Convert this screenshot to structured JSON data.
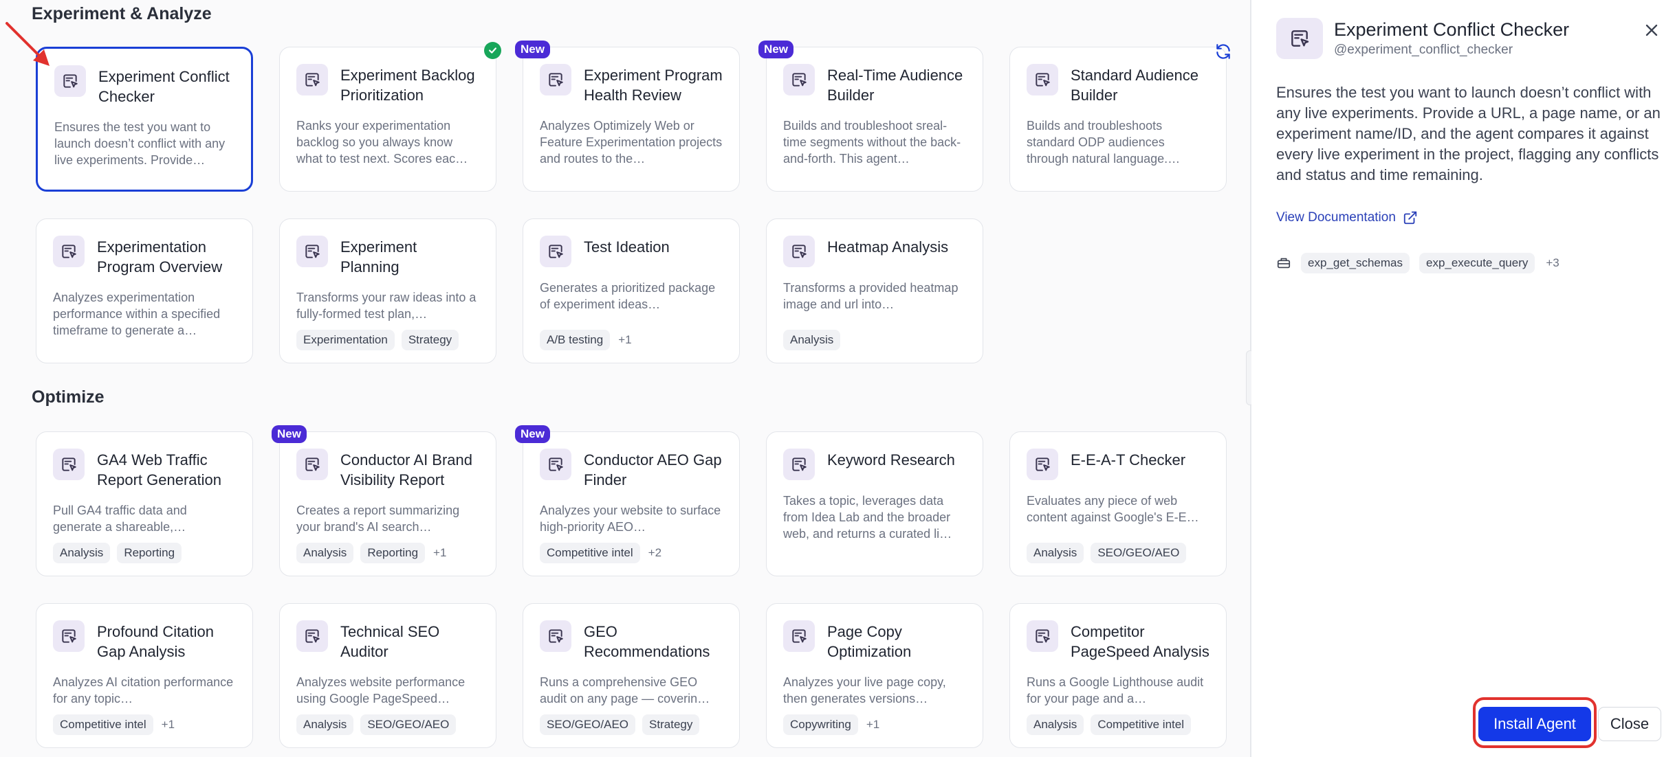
{
  "sections": {
    "experiment": {
      "title": "Experiment & Analyze"
    },
    "optimize": {
      "title": "Optimize"
    }
  },
  "experiment_cards": [
    {
      "title": "Experiment Conflict Checker",
      "desc": "Ensures the test you want to launch doesn’t conflict with any live experiments. Provide…",
      "tags": [],
      "more": "",
      "badge": "",
      "selected": true
    },
    {
      "title": "Experiment Backlog Prioritization",
      "desc": "Ranks your experimentation backlog so you always know what to test next. Scores eac…",
      "tags": [],
      "more": "",
      "badge": "check"
    },
    {
      "title": "Experiment Program Health Review",
      "desc": "Analyzes Optimizely Web or Feature Experimentation projects and routes to the…",
      "tags": [],
      "more": "",
      "badge": "New"
    },
    {
      "title": "Real-Time Audience Builder",
      "desc": "Builds and troubleshoot sreal-time segments without the back-and-forth. This agent…",
      "tags": [],
      "more": "",
      "badge": "New"
    },
    {
      "title": "Standard Audience Builder",
      "desc": "Builds and troubleshoots standard ODP audiences through natural language.…",
      "tags": [],
      "more": "",
      "badge": ""
    },
    {
      "title": "Experimentation Program Overview",
      "desc": "Analyzes experimentation performance within a specified timeframe to generate a…",
      "tags": [],
      "more": "",
      "badge": ""
    },
    {
      "title": "Experiment Planning",
      "desc": "Transforms your raw ideas into a fully-formed test plan,…",
      "tags": [
        "Experimentation",
        "Strategy"
      ],
      "more": "",
      "badge": ""
    },
    {
      "title": "Test Ideation",
      "desc": "Generates a prioritized package of experiment ideas…",
      "tags": [
        "A/B testing"
      ],
      "more": "+1",
      "badge": ""
    },
    {
      "title": "Heatmap Analysis",
      "desc": "Transforms a provided heatmap image and url into…",
      "tags": [
        "Analysis"
      ],
      "more": "",
      "badge": ""
    }
  ],
  "optimize_cards": [
    {
      "title": "GA4 Web Traffic Report Generation",
      "desc": "Pull GA4 traffic data and generate a shareable,…",
      "tags": [
        "Analysis",
        "Reporting"
      ],
      "more": "",
      "badge": ""
    },
    {
      "title": "Conductor AI Brand Visibility Report",
      "desc": "Creates a report summarizing your brand's AI search…",
      "tags": [
        "Analysis",
        "Reporting"
      ],
      "more": "+1",
      "badge": "New"
    },
    {
      "title": "Conductor AEO Gap Finder",
      "desc": "Analyzes your website to surface high-priority AEO…",
      "tags": [
        "Competitive intel"
      ],
      "more": "+2",
      "badge": "New"
    },
    {
      "title": "Keyword Research",
      "desc": "Takes a topic, leverages data from Idea Lab and the broader web, and returns a curated li…",
      "tags": [],
      "more": "",
      "badge": ""
    },
    {
      "title": "E-E-A-T Checker",
      "desc": "Evaluates any piece of web content against Google's E-E…",
      "tags": [
        "Analysis",
        "SEO/GEO/AEO"
      ],
      "more": "",
      "badge": ""
    },
    {
      "title": "Profound Citation Gap Analysis",
      "desc": "Analyzes AI citation performance for any topic…",
      "tags": [
        "Competitive intel"
      ],
      "more": "+1",
      "badge": ""
    },
    {
      "title": "Technical SEO Auditor",
      "desc": "Analyzes website performance using Google PageSpeed…",
      "tags": [
        "Analysis",
        "SEO/GEO/AEO"
      ],
      "more": "",
      "badge": ""
    },
    {
      "title": "GEO Recommendations",
      "desc": "Runs a comprehensive GEO audit on any page — coverin…",
      "tags": [
        "SEO/GEO/AEO",
        "Strategy"
      ],
      "more": "",
      "badge": ""
    },
    {
      "title": "Page Copy Optimization",
      "desc": "Analyzes your live page copy, then generates versions…",
      "tags": [
        "Copywriting"
      ],
      "more": "+1",
      "badge": ""
    },
    {
      "title": "Competitor PageSpeed Analysis",
      "desc": "Runs a Google Lighthouse audit for your page and a…",
      "tags": [
        "Analysis",
        "Competitive intel"
      ],
      "more": "",
      "badge": ""
    }
  ],
  "panel": {
    "title": "Experiment Conflict Checker",
    "handle": "@experiment_conflict_checker",
    "description": "Ensures the test you want to launch doesn’t conflict with any live experiments. Provide a URL, a page name, or an experiment name/ID, and the agent compares it against every live experiment in the project, flagging any conflicts and status and time remaining.",
    "doc_link": "View Documentation",
    "tools": [
      "exp_get_schemas",
      "exp_execute_query"
    ],
    "tools_more": "+3",
    "install_label": "Install Agent",
    "close_label": "Close"
  },
  "colors": {
    "accent": "#1439e8",
    "selected_border": "#1a3fd6",
    "new_badge": "#4b2bd6",
    "check_badge": "#18a65a",
    "annotation_red": "#e1322e"
  }
}
